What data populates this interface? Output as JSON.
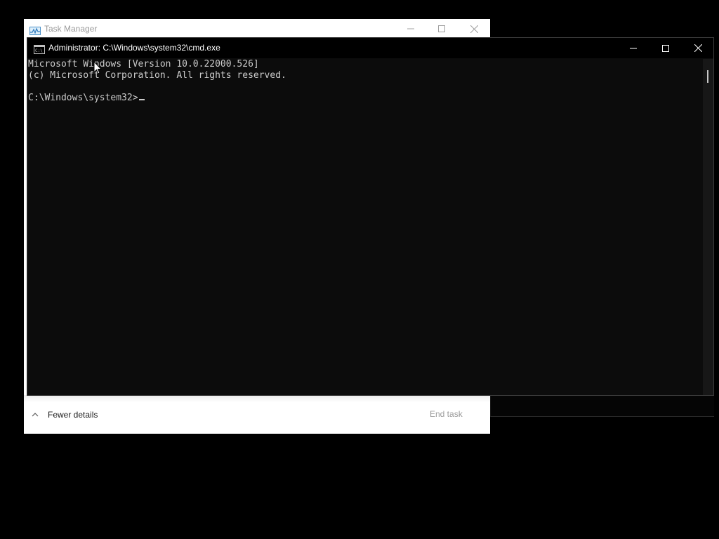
{
  "task_manager": {
    "title": "Task Manager",
    "icon": "task-manager-icon",
    "controls": {
      "minimize_icon": "minimize-icon",
      "maximize_icon": "maximize-icon",
      "close_icon": "close-icon"
    },
    "footer": {
      "fewer_details_label": "Fewer details",
      "end_task_label": "End task",
      "chevron_icon": "chevron-up-icon"
    }
  },
  "cmd": {
    "title": "Administrator: C:\\Windows\\system32\\cmd.exe",
    "icon": "cmd-icon",
    "controls": {
      "minimize_icon": "minimize-icon",
      "maximize_icon": "maximize-icon",
      "close_icon": "close-icon"
    },
    "console_lines": [
      "Microsoft Windows [Version 10.0.22000.526]",
      "(c) Microsoft Corporation. All rights reserved.",
      "",
      "C:\\Windows\\system32>"
    ]
  },
  "colors": {
    "desktop_bg": "#000000",
    "console_bg": "#0c0c0c",
    "console_text": "#cccccc",
    "cmd_titlebar": "#000000",
    "tm_bg": "#ffffff"
  }
}
